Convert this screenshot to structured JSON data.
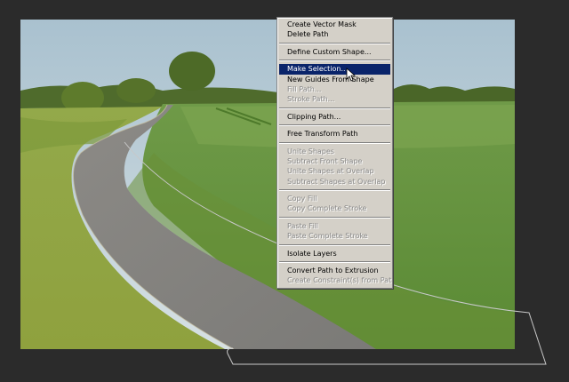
{
  "context_menu": {
    "items": [
      {
        "label": "Create Vector Mask",
        "enabled": true
      },
      {
        "label": "Delete Path",
        "enabled": true
      },
      {
        "separator": true
      },
      {
        "label": "Define Custom Shape...",
        "enabled": true
      },
      {
        "separator": true
      },
      {
        "label": "Make Selection...",
        "enabled": true,
        "highlighted": true
      },
      {
        "label": "New Guides From Shape",
        "enabled": true
      },
      {
        "label": "Fill Path...",
        "enabled": false
      },
      {
        "label": "Stroke Path...",
        "enabled": false
      },
      {
        "separator": true
      },
      {
        "label": "Clipping Path...",
        "enabled": true
      },
      {
        "separator": true
      },
      {
        "label": "Free Transform Path",
        "enabled": true
      },
      {
        "separator": true
      },
      {
        "label": "Unite Shapes",
        "enabled": false
      },
      {
        "label": "Subtract Front Shape",
        "enabled": false
      },
      {
        "label": "Unite Shapes at Overlap",
        "enabled": false
      },
      {
        "label": "Subtract Shapes at Overlap",
        "enabled": false
      },
      {
        "separator": true
      },
      {
        "label": "Copy Fill",
        "enabled": false
      },
      {
        "label": "Copy Complete Stroke",
        "enabled": false
      },
      {
        "separator": true
      },
      {
        "label": "Paste Fill",
        "enabled": false
      },
      {
        "label": "Paste Complete Stroke",
        "enabled": false
      },
      {
        "separator": true
      },
      {
        "label": "Isolate Layers",
        "enabled": true
      },
      {
        "separator": true
      },
      {
        "label": "Convert Path to Extrusion",
        "enabled": true
      },
      {
        "label": "Create Constraint(s) from Path",
        "enabled": false
      }
    ]
  },
  "colors": {
    "workspace": "#282828",
    "menu_bg": "#d4d0c8",
    "highlight": "#0a246a",
    "path": "#c8c8c8"
  }
}
